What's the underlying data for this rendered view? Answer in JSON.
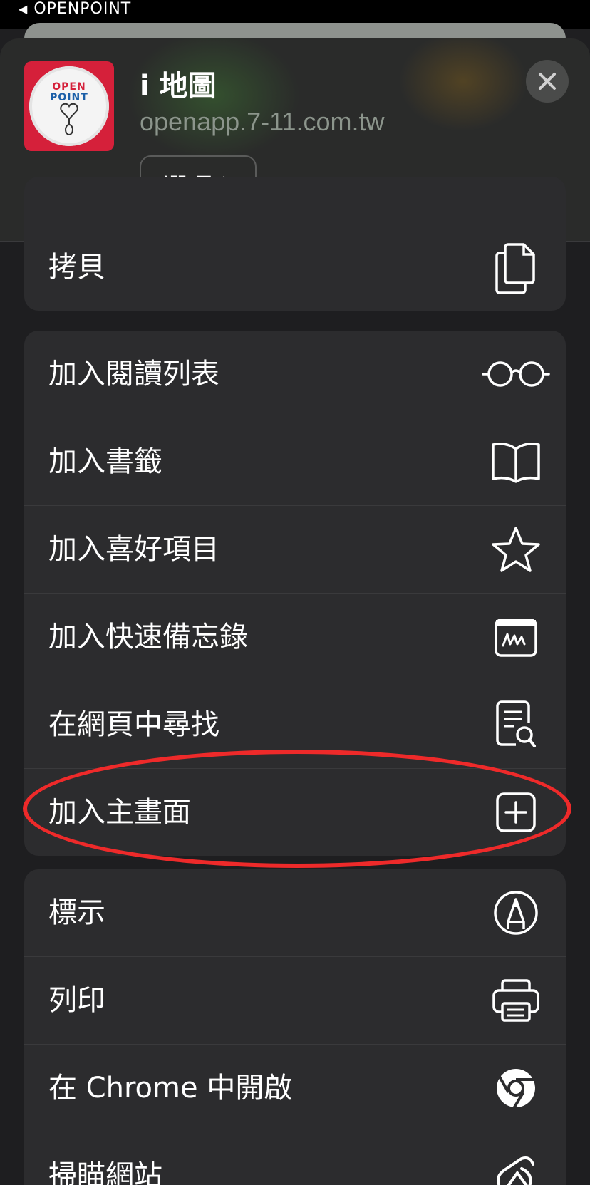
{
  "status_bar": {
    "back_app": "OPENPOINT"
  },
  "header": {
    "app_icon_text_line1": "OPEN",
    "app_icon_text_line2": "POINT",
    "title": "i 地圖",
    "url": "openapp.7-11.com.tw",
    "options_label": "選項"
  },
  "copy_group": [
    {
      "label": "拷貝",
      "icon": "copy-icon"
    }
  ],
  "group_two": [
    {
      "label": "加入閱讀列表",
      "icon": "glasses-icon"
    },
    {
      "label": "加入書籤",
      "icon": "book-icon"
    },
    {
      "label": "加入喜好項目",
      "icon": "star-icon"
    },
    {
      "label": "加入快速備忘錄",
      "icon": "quick-note-icon"
    },
    {
      "label": "在網頁中尋找",
      "icon": "find-in-page-icon"
    },
    {
      "label": "加入主畫面",
      "icon": "add-square-icon"
    }
  ],
  "group_three": [
    {
      "label": "標示",
      "icon": "markup-icon"
    },
    {
      "label": "列印",
      "icon": "printer-icon"
    },
    {
      "label": "在 Chrome 中開啟",
      "icon": "chrome-icon"
    },
    {
      "label": "掃瞄網站",
      "icon": "scan-icon"
    }
  ],
  "colors": {
    "highlight": "#ee2a2a",
    "row_bg": "#2c2c2e",
    "brand_red": "#d5203a"
  }
}
